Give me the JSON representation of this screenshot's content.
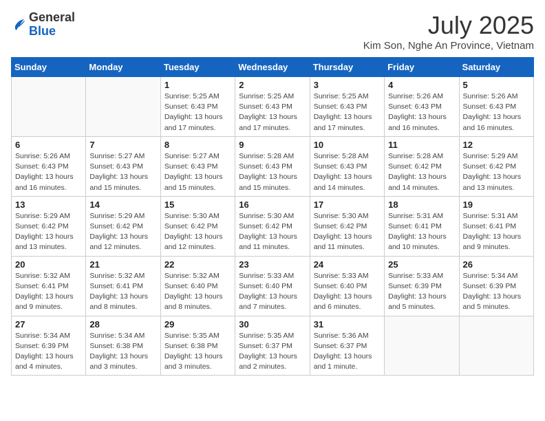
{
  "header": {
    "logo_general": "General",
    "logo_blue": "Blue",
    "month_title": "July 2025",
    "location": "Kim Son, Nghe An Province, Vietnam"
  },
  "days_of_week": [
    "Sunday",
    "Monday",
    "Tuesday",
    "Wednesday",
    "Thursday",
    "Friday",
    "Saturday"
  ],
  "weeks": [
    [
      {
        "day": "",
        "info": ""
      },
      {
        "day": "",
        "info": ""
      },
      {
        "day": "1",
        "info": "Sunrise: 5:25 AM\nSunset: 6:43 PM\nDaylight: 13 hours and 17 minutes."
      },
      {
        "day": "2",
        "info": "Sunrise: 5:25 AM\nSunset: 6:43 PM\nDaylight: 13 hours and 17 minutes."
      },
      {
        "day": "3",
        "info": "Sunrise: 5:25 AM\nSunset: 6:43 PM\nDaylight: 13 hours and 17 minutes."
      },
      {
        "day": "4",
        "info": "Sunrise: 5:26 AM\nSunset: 6:43 PM\nDaylight: 13 hours and 16 minutes."
      },
      {
        "day": "5",
        "info": "Sunrise: 5:26 AM\nSunset: 6:43 PM\nDaylight: 13 hours and 16 minutes."
      }
    ],
    [
      {
        "day": "6",
        "info": "Sunrise: 5:26 AM\nSunset: 6:43 PM\nDaylight: 13 hours and 16 minutes."
      },
      {
        "day": "7",
        "info": "Sunrise: 5:27 AM\nSunset: 6:43 PM\nDaylight: 13 hours and 15 minutes."
      },
      {
        "day": "8",
        "info": "Sunrise: 5:27 AM\nSunset: 6:43 PM\nDaylight: 13 hours and 15 minutes."
      },
      {
        "day": "9",
        "info": "Sunrise: 5:28 AM\nSunset: 6:43 PM\nDaylight: 13 hours and 15 minutes."
      },
      {
        "day": "10",
        "info": "Sunrise: 5:28 AM\nSunset: 6:43 PM\nDaylight: 13 hours and 14 minutes."
      },
      {
        "day": "11",
        "info": "Sunrise: 5:28 AM\nSunset: 6:42 PM\nDaylight: 13 hours and 14 minutes."
      },
      {
        "day": "12",
        "info": "Sunrise: 5:29 AM\nSunset: 6:42 PM\nDaylight: 13 hours and 13 minutes."
      }
    ],
    [
      {
        "day": "13",
        "info": "Sunrise: 5:29 AM\nSunset: 6:42 PM\nDaylight: 13 hours and 13 minutes."
      },
      {
        "day": "14",
        "info": "Sunrise: 5:29 AM\nSunset: 6:42 PM\nDaylight: 13 hours and 12 minutes."
      },
      {
        "day": "15",
        "info": "Sunrise: 5:30 AM\nSunset: 6:42 PM\nDaylight: 13 hours and 12 minutes."
      },
      {
        "day": "16",
        "info": "Sunrise: 5:30 AM\nSunset: 6:42 PM\nDaylight: 13 hours and 11 minutes."
      },
      {
        "day": "17",
        "info": "Sunrise: 5:30 AM\nSunset: 6:42 PM\nDaylight: 13 hours and 11 minutes."
      },
      {
        "day": "18",
        "info": "Sunrise: 5:31 AM\nSunset: 6:41 PM\nDaylight: 13 hours and 10 minutes."
      },
      {
        "day": "19",
        "info": "Sunrise: 5:31 AM\nSunset: 6:41 PM\nDaylight: 13 hours and 9 minutes."
      }
    ],
    [
      {
        "day": "20",
        "info": "Sunrise: 5:32 AM\nSunset: 6:41 PM\nDaylight: 13 hours and 9 minutes."
      },
      {
        "day": "21",
        "info": "Sunrise: 5:32 AM\nSunset: 6:41 PM\nDaylight: 13 hours and 8 minutes."
      },
      {
        "day": "22",
        "info": "Sunrise: 5:32 AM\nSunset: 6:40 PM\nDaylight: 13 hours and 8 minutes."
      },
      {
        "day": "23",
        "info": "Sunrise: 5:33 AM\nSunset: 6:40 PM\nDaylight: 13 hours and 7 minutes."
      },
      {
        "day": "24",
        "info": "Sunrise: 5:33 AM\nSunset: 6:40 PM\nDaylight: 13 hours and 6 minutes."
      },
      {
        "day": "25",
        "info": "Sunrise: 5:33 AM\nSunset: 6:39 PM\nDaylight: 13 hours and 5 minutes."
      },
      {
        "day": "26",
        "info": "Sunrise: 5:34 AM\nSunset: 6:39 PM\nDaylight: 13 hours and 5 minutes."
      }
    ],
    [
      {
        "day": "27",
        "info": "Sunrise: 5:34 AM\nSunset: 6:39 PM\nDaylight: 13 hours and 4 minutes."
      },
      {
        "day": "28",
        "info": "Sunrise: 5:34 AM\nSunset: 6:38 PM\nDaylight: 13 hours and 3 minutes."
      },
      {
        "day": "29",
        "info": "Sunrise: 5:35 AM\nSunset: 6:38 PM\nDaylight: 13 hours and 3 minutes."
      },
      {
        "day": "30",
        "info": "Sunrise: 5:35 AM\nSunset: 6:37 PM\nDaylight: 13 hours and 2 minutes."
      },
      {
        "day": "31",
        "info": "Sunrise: 5:36 AM\nSunset: 6:37 PM\nDaylight: 13 hours and 1 minute."
      },
      {
        "day": "",
        "info": ""
      },
      {
        "day": "",
        "info": ""
      }
    ]
  ]
}
